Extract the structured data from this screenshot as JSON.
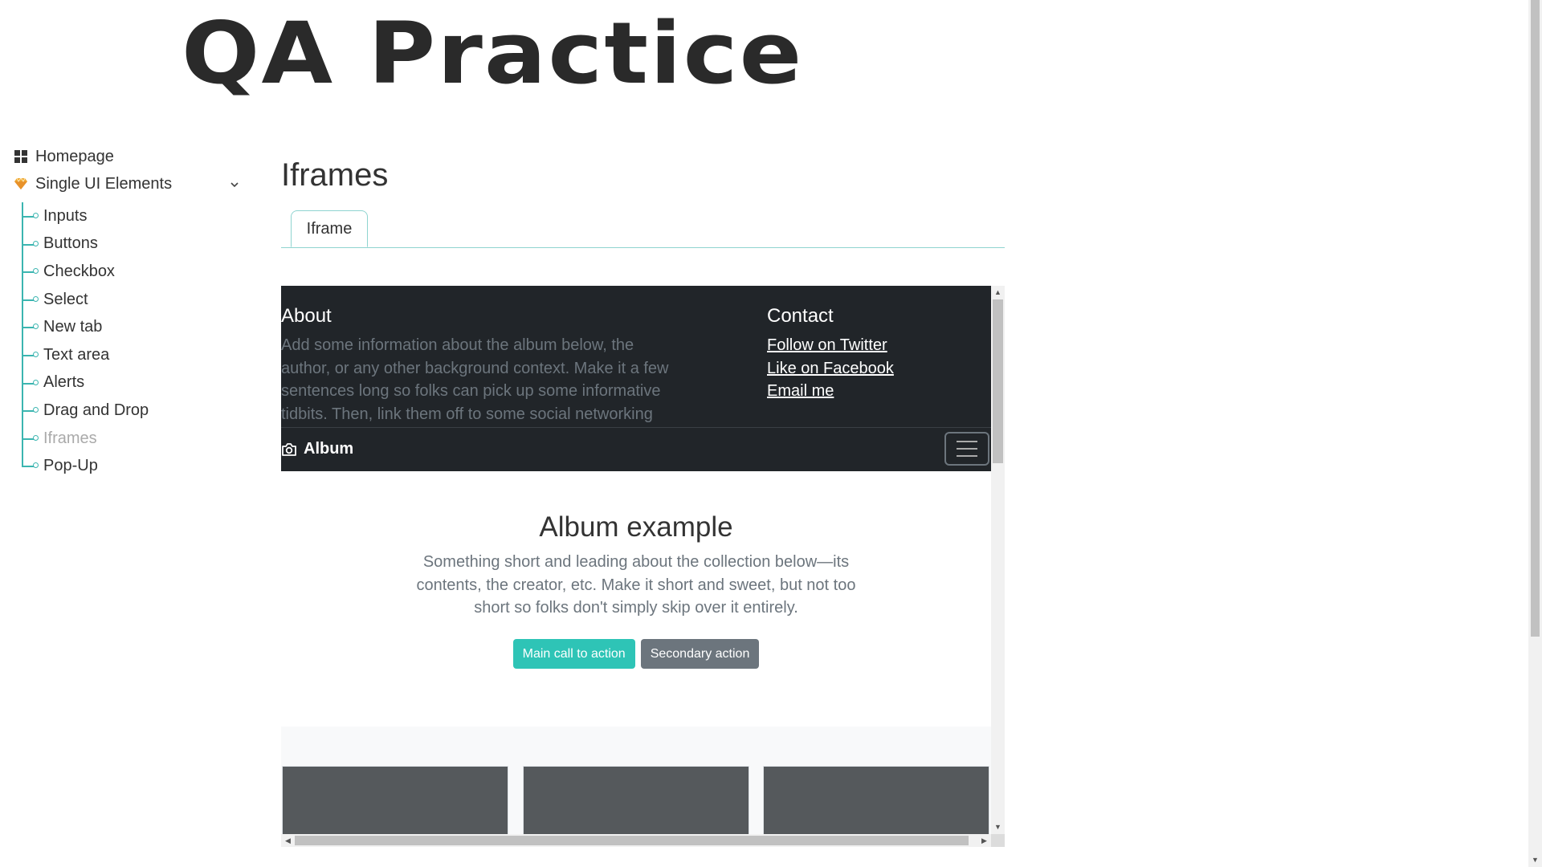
{
  "site": {
    "logo": "QA Practice"
  },
  "sidebar": {
    "homepage": {
      "label": "Homepage",
      "icon": "grid-icon"
    },
    "section": {
      "label": "Single UI Elements",
      "icon": "gem-icon",
      "expanded": true
    },
    "items": [
      {
        "label": "Inputs"
      },
      {
        "label": "Buttons"
      },
      {
        "label": "Checkbox"
      },
      {
        "label": "Select"
      },
      {
        "label": "New tab"
      },
      {
        "label": "Text area"
      },
      {
        "label": "Alerts"
      },
      {
        "label": "Drag and Drop"
      },
      {
        "label": "Iframes",
        "active": true
      },
      {
        "label": "Pop-Up"
      }
    ]
  },
  "main": {
    "title": "Iframes",
    "tabs": [
      {
        "label": "Iframe",
        "active": true
      }
    ]
  },
  "iframe": {
    "about": {
      "heading": "About",
      "text": "Add some information about the album below, the author, or any other background context. Make it a few sentences long so folks can pick up some informative tidbits. Then, link them off to some social networking sites or contact information."
    },
    "contact": {
      "heading": "Contact",
      "links": [
        "Follow on Twitter",
        "Like on Facebook",
        "Email me"
      ]
    },
    "navbar": {
      "brand": "Album",
      "brand_icon": "camera-icon",
      "toggler_icon": "hamburger-icon"
    },
    "hero": {
      "heading": "Album example",
      "text": "Something short and leading about the collection below—its contents, the creator, etc. Make it short and sweet, but not too short so folks don't simply skip over it entirely.",
      "primary_button": "Main call to action",
      "secondary_button": "Secondary action"
    }
  },
  "colors": {
    "accent": "#2ec4b6",
    "tree_line": "#3bb5b0",
    "dark": "#212529",
    "muted": "#6c757d",
    "gem": "#f0a830"
  }
}
